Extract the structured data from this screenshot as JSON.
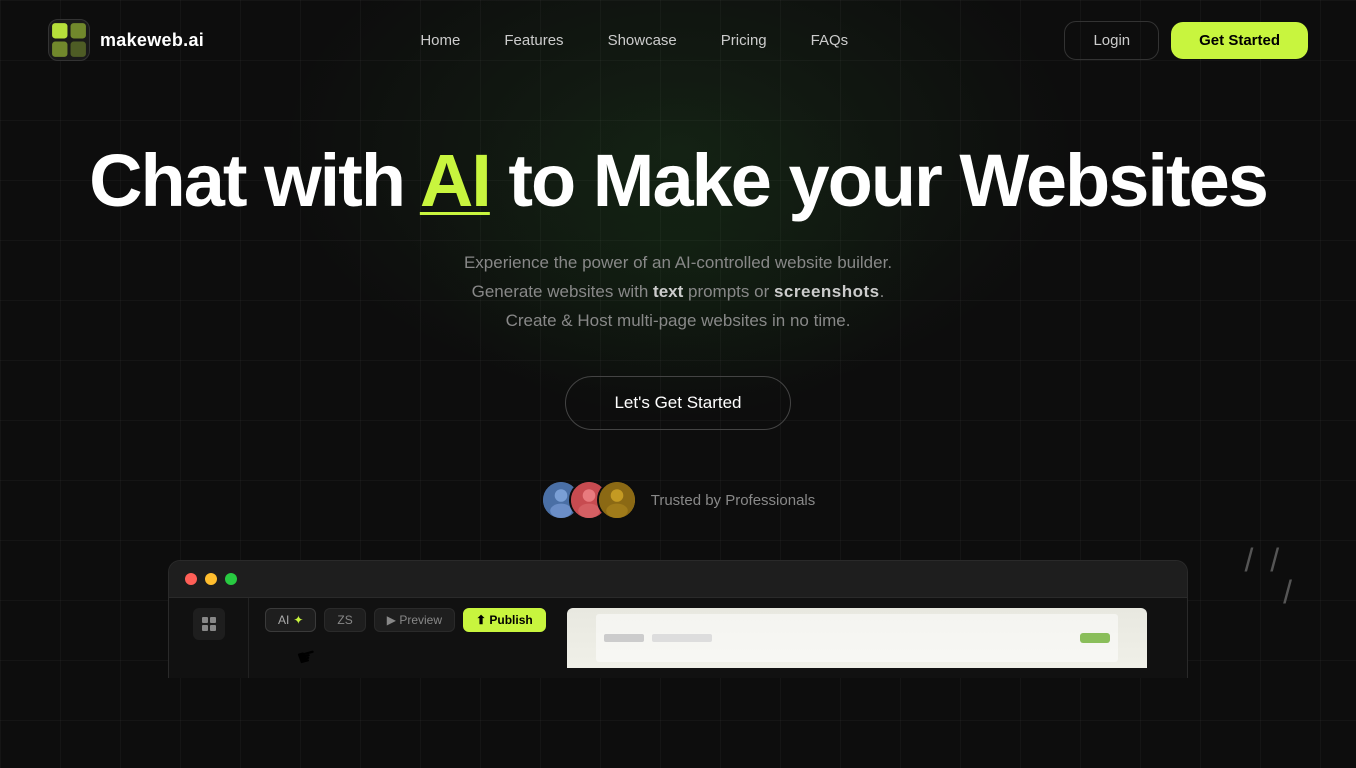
{
  "brand": {
    "logo_text": "makeweb.ai",
    "logo_icon_label": "makeweb logo"
  },
  "nav": {
    "links": [
      {
        "id": "home",
        "label": "Home"
      },
      {
        "id": "features",
        "label": "Features"
      },
      {
        "id": "showcase",
        "label": "Showcase"
      },
      {
        "id": "pricing",
        "label": "Pricing"
      },
      {
        "id": "faqs",
        "label": "FAQs"
      }
    ],
    "login_label": "Login",
    "get_started_label": "Get Started"
  },
  "hero": {
    "title_part1": "Chat with ",
    "title_highlight": "AI",
    "title_part2": " to Make your Websites",
    "subtitle_line1": "Experience the power of an AI-controlled website builder.",
    "subtitle_line2_prefix": "Generate websites with ",
    "subtitle_text_bold": "text",
    "subtitle_line2_mid": " prompts or ",
    "subtitle_screenshots_bold": "screenshots",
    "subtitle_line2_suffix": ".",
    "subtitle_line3": "Create & Host multi-page websites in no time.",
    "cta_label": "Let's Get Started"
  },
  "trust": {
    "text": "Trusted by Professionals",
    "avatars": [
      {
        "id": "avatar-1",
        "label": "User 1"
      },
      {
        "id": "avatar-2",
        "label": "User 2"
      },
      {
        "id": "avatar-3",
        "label": "User 3"
      }
    ]
  },
  "browser": {
    "toolbar_buttons": [
      {
        "id": "ai-btn",
        "label": "AI ✦"
      },
      {
        "id": "zs-btn",
        "label": "ZS"
      },
      {
        "id": "preview-btn",
        "label": "▶ Preview"
      },
      {
        "id": "publish-btn",
        "label": "⬆ Publish"
      }
    ]
  },
  "deco": {
    "slashes": "/ /\n   /"
  },
  "colors": {
    "accent": "#c8f53e",
    "background": "#0d0d0d",
    "text_primary": "#ffffff",
    "text_secondary": "#888888",
    "border": "#2a2a2a"
  }
}
